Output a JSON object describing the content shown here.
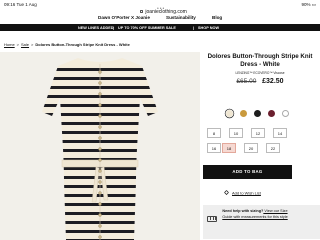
{
  "status_bar": {
    "time": "09:16",
    "date": "Tue 1 Aug",
    "signal": "•••",
    "battery": "90% ▭"
  },
  "browser": {
    "url": "joanieclothing.com",
    "menu_dots": "•••"
  },
  "nav": {
    "items": [
      "Dawn O'Porter X Joanie",
      "Sustainability",
      "Blog"
    ]
  },
  "promo": {
    "items": [
      "NEW LINES ADDED",
      "UP TO 70% OFF SUMMER SALE",
      "SHOP NOW"
    ]
  },
  "breadcrumb": {
    "home": "Home",
    "sale": "Sale",
    "current": "Dolores Button-Through Stripe Knit Dress - White"
  },
  "product": {
    "title": "Dolores Button-Through Stripe Knit Dress - White",
    "reviews_text": "LENZING™ ECOVERO™ Viscose",
    "price_was": "£65.00",
    "price_now": "£32.50"
  },
  "swatches": [
    {
      "name": "cream-stripe",
      "color": "#efe6d2",
      "selected": true
    },
    {
      "name": "mustard",
      "color": "#c99a3d",
      "selected": false
    },
    {
      "name": "black",
      "color": "#1d1d1d",
      "selected": false
    },
    {
      "name": "burgundy",
      "color": "#6b1f2e",
      "selected": false
    },
    {
      "name": "white-stripe",
      "color": "#ffffff",
      "selected": false
    }
  ],
  "sizes": [
    "8",
    "10",
    "12",
    "14",
    "16",
    "18",
    "20",
    "22"
  ],
  "selected_size": "18",
  "actions": {
    "add_to_bag": "ADD TO BAG",
    "wishlist": "Add to Wish List"
  },
  "help": {
    "title": "Need help with sizing?",
    "body": " View our Size Guide with measurements for this style"
  },
  "colors": {
    "accent": "#111111",
    "selected_size_bg": "#f6d9d2",
    "promo_bg": "#111111",
    "help_bg": "#eeeeee"
  }
}
